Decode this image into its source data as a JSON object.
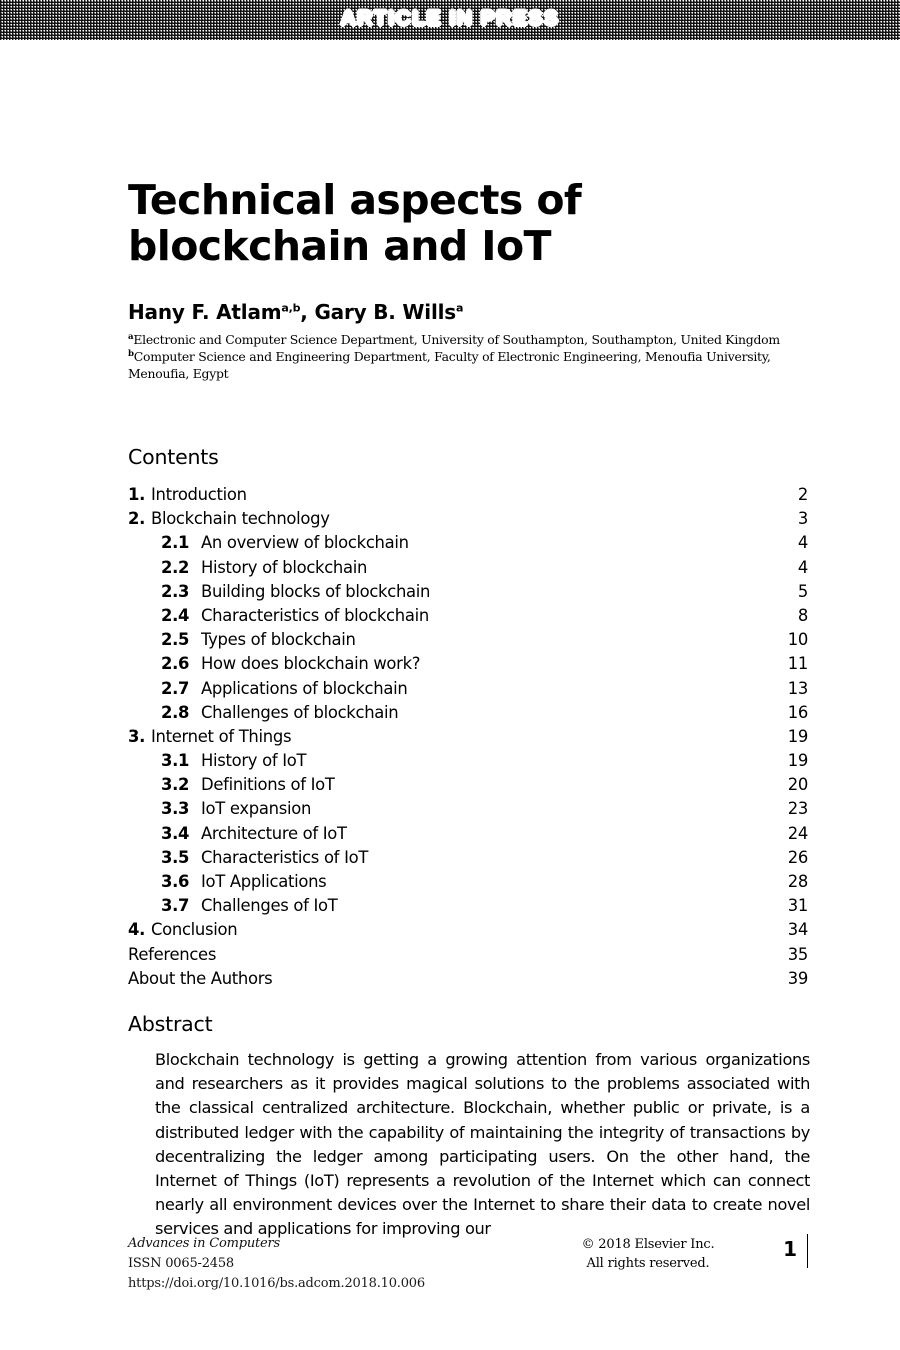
{
  "banner": {
    "text": "ARTICLE IN PRESS"
  },
  "title": "Technical aspects of blockchain and IoT",
  "authors": {
    "line_html": "Hany F. Atlam",
    "name1": "Hany F. Atlam",
    "sup1": "a,b",
    "separator": ", ",
    "name2": "Gary B. Wills",
    "sup2": "a"
  },
  "affiliations": [
    {
      "marker": "a",
      "text": "Electronic and Computer Science Department, University of Southampton, Southampton, United Kingdom"
    },
    {
      "marker": "b",
      "text": "Computer Science and Engineering Department, Faculty of Electronic Engineering, Menoufia University, Menoufia, Egypt"
    }
  ],
  "contents": {
    "heading": "Contents",
    "entries": [
      {
        "level": 1,
        "number": "1.",
        "label": "Introduction",
        "page": "2"
      },
      {
        "level": 1,
        "number": "2.",
        "label": "Blockchain technology",
        "page": "3"
      },
      {
        "level": 2,
        "number": "2.1",
        "label": "An overview of blockchain",
        "page": "4"
      },
      {
        "level": 2,
        "number": "2.2",
        "label": "History of blockchain",
        "page": "4"
      },
      {
        "level": 2,
        "number": "2.3",
        "label": "Building blocks of blockchain",
        "page": "5"
      },
      {
        "level": 2,
        "number": "2.4",
        "label": "Characteristics of blockchain",
        "page": "8"
      },
      {
        "level": 2,
        "number": "2.5",
        "label": "Types of blockchain",
        "page": "10"
      },
      {
        "level": 2,
        "number": "2.6",
        "label": "How does blockchain work?",
        "page": "11"
      },
      {
        "level": 2,
        "number": "2.7",
        "label": "Applications of blockchain",
        "page": "13"
      },
      {
        "level": 2,
        "number": "2.8",
        "label": "Challenges of blockchain",
        "page": "16"
      },
      {
        "level": 1,
        "number": "3.",
        "label": "Internet of Things",
        "page": "19"
      },
      {
        "level": 2,
        "number": "3.1",
        "label": "History of IoT",
        "page": "19"
      },
      {
        "level": 2,
        "number": "3.2",
        "label": "Definitions of IoT",
        "page": "20"
      },
      {
        "level": 2,
        "number": "3.3",
        "label": "IoT expansion",
        "page": "23"
      },
      {
        "level": 2,
        "number": "3.4",
        "label": "Architecture of IoT",
        "page": "24"
      },
      {
        "level": 2,
        "number": "3.5",
        "label": "Characteristics of IoT",
        "page": "26"
      },
      {
        "level": 2,
        "number": "3.6",
        "label": "IoT Applications",
        "page": "28"
      },
      {
        "level": 2,
        "number": "3.7",
        "label": "Challenges of IoT",
        "page": "31"
      },
      {
        "level": 1,
        "number": "4.",
        "label": "Conclusion",
        "page": "34"
      },
      {
        "level": 0,
        "number": "",
        "label": "References",
        "page": "35"
      },
      {
        "level": 0,
        "number": "",
        "label": "About the Authors",
        "page": "39"
      }
    ]
  },
  "abstract": {
    "heading": "Abstract",
    "text": "Blockchain technology is getting a growing attention from various organizations and researchers as it provides magical solutions to the problems associated with the classical centralized architecture. Blockchain, whether public or private, is a distributed ledger with the capability of maintaining the integrity of transactions by decentralizing the ledger among participating users. On the other hand, the Internet of Things (IoT) represents a revolution of the Internet which can connect nearly all environment devices over the Internet to share their data to create novel services and applications for improving our"
  },
  "footer": {
    "journal": "Advances in Computers",
    "issn": "ISSN 0065-2458",
    "doi": "https://doi.org/10.1016/bs.adcom.2018.10.006",
    "copyright": "© 2018 Elsevier Inc.",
    "rights": "All rights reserved.",
    "page_number": "1"
  }
}
